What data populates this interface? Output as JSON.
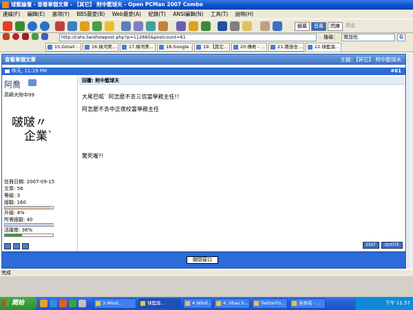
{
  "window": {
    "title": "球藍論壇 - 查看單個文章 - 【其它】 附中籃球夫 - Open PCMan 2007 Combo"
  },
  "menu": [
    "連線(F)",
    "編輯(E)",
    "選項(Y)",
    "BBS最愛(B)",
    "Web最愛(A)",
    "紀錄(T)",
    "ANSI編輯(N)",
    "工具(T)",
    "說明(H)"
  ],
  "right_tabs": {
    "tab1": "銀幕",
    "tab2": "音幕",
    "tab3": "閃爍",
    "tab4": "退出"
  },
  "address": {
    "url": "http://cshs.tw/showpost.php?p=112665&postcount=61"
  },
  "search": {
    "label": "搜尋：",
    "value": "南加也"
  },
  "browser_tabs": [
    "15.Gmail - ...",
    "16.綠河美...",
    "17.綠河美...",
    "18.Google ...",
    "19.【其它...",
    "20.傳奇 - ...",
    "21.南佳也 ...",
    "22.球藍論..."
  ],
  "page": {
    "header_title": "查看單個文章",
    "subject_label": "主題：",
    "subject_value": "【其它】 附中籃球夫",
    "date": "昨天, 11:19 PM",
    "post_number": "#61"
  },
  "user": {
    "name": "阿喬",
    "school": "高師大附中99",
    "avatar_line1": "啵啵〃",
    "avatar_line2": "企業`",
    "stats": {
      "joined": "註冊日期: 2007-09-15",
      "posts": "文章: 56",
      "level": "等級: 3",
      "exp": "經驗: 160",
      "exp_pct": 0.95,
      "upgrade": "升級: 4%",
      "upgrade_pct": 0.04,
      "required": "所需經驗: 40",
      "required_pct": 0.98,
      "activity": "活躍度: 36%",
      "activity_pct": 0.36
    }
  },
  "post": {
    "reply_title": "回覆: 附中籃球夫",
    "line1": "大尾巴呱` 阿怎麼不去三信當學務主任!!",
    "line2": "阿怎麼不去中正夜校當學務主任",
    "line3": "驚死喔?!",
    "edit": "EDIT",
    "quote": "QUOTE"
  },
  "footer": {
    "close": "關閉窗口"
  },
  "statusbar": {
    "text": "完成"
  },
  "taskbar": {
    "start": "開始",
    "tasks": [
      "3 Wind...",
      "球藍論...",
      "4 Wind...",
      "4. Shao S...",
      "TwitterFo...",
      "未命名 - ..."
    ],
    "clock": "下午 11:57"
  }
}
